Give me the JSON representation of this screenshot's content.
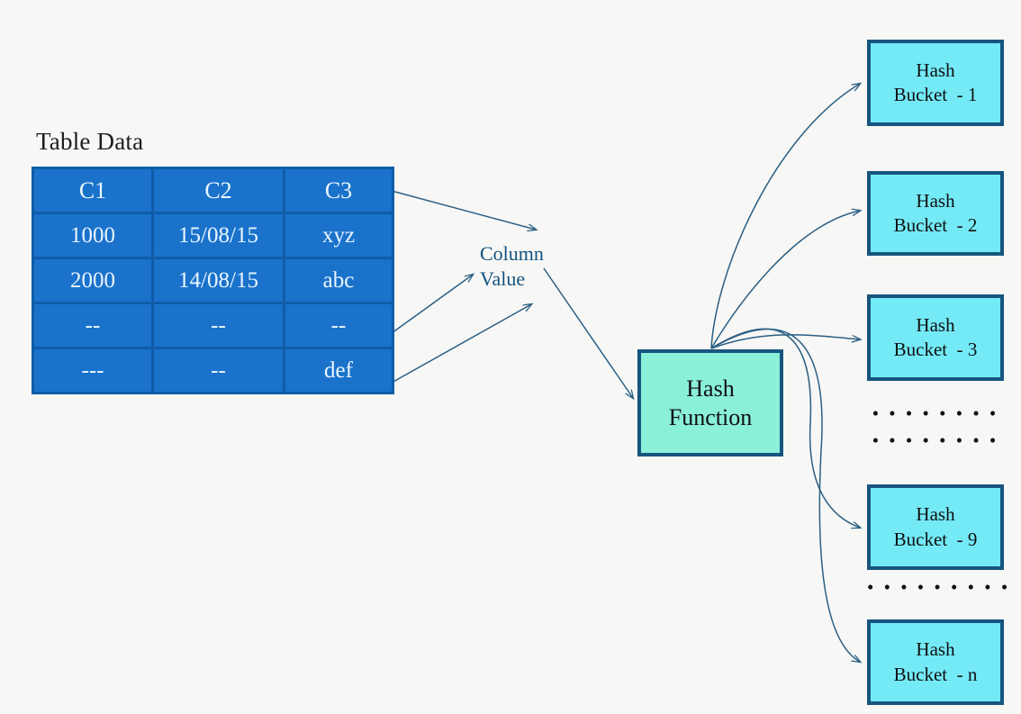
{
  "background_color": "#f7f7f5",
  "table": {
    "title": "Table Data",
    "header_fill": "#1a72cb",
    "border_color": "#0f5ca8",
    "text_color": "#eaf6ff",
    "columns": [
      "C1",
      "C2",
      "C3"
    ],
    "rows": [
      [
        "1000",
        "15/08/15",
        "xyz"
      ],
      [
        "2000",
        "14/08/15",
        "abc"
      ],
      [
        "--",
        "--",
        "--"
      ],
      [
        "---",
        "--",
        "def"
      ]
    ]
  },
  "column_value": {
    "line1": "Column",
    "line2": "Value",
    "color": "#13537f"
  },
  "hash_function": {
    "line1": "Hash",
    "line2": "Function",
    "fill": "#8af0d8",
    "border": "#17557f"
  },
  "buckets": {
    "fill": "#74eaf7",
    "border": "#17557f",
    "items": [
      {
        "line1": "Hash",
        "line2": "Bucket  - 1"
      },
      {
        "line1": "Hash",
        "line2": "Bucket  - 2"
      },
      {
        "line1": "Hash",
        "line2": "Bucket  - 3"
      },
      {
        "line1": "Hash",
        "line2": "Bucket  - 9"
      },
      {
        "line1": "Hash",
        "line2": "Bucket  - n"
      }
    ]
  },
  "ellipses": {
    "row1": "• • • • • • • •",
    "row2": "• • • • • • • •",
    "row3": "• • • • • • • • •"
  },
  "arrow_color": "#2a5f84"
}
